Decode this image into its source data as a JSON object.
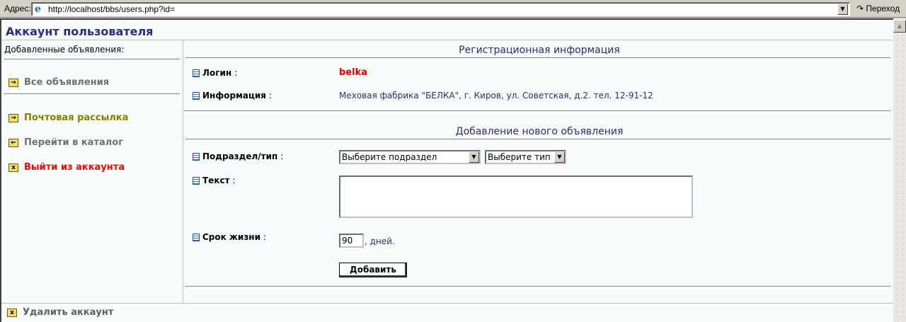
{
  "browser": {
    "address_label": "Адрес:",
    "url": "http://localhost/bbs/users.php?id=",
    "go_label": "Переход"
  },
  "page": {
    "title": "Аккаунт пользователя",
    "sidebar": {
      "heading": "Добавленные объявления:",
      "items": [
        {
          "label": "Все объявления",
          "color": "#707070"
        },
        {
          "label": "Почтовая рассылка",
          "color": "#808000"
        },
        {
          "label": "Перейти в каталог",
          "color": "#707070"
        },
        {
          "label": "Выйти из аккаунта",
          "color": "#ff0000"
        }
      ],
      "delete_account": "Удалить аккаунт"
    },
    "registration": {
      "title": "Регистрационная информация",
      "login_label": "Логин",
      "login_value": "belka",
      "info_label": "Информация",
      "info_value": "Меховая фабрика \"БЕЛКА\", г. Киров, ул. Советская, д.2. тел. 12-91-12"
    },
    "new_ad": {
      "title": "Добавление нового объявления",
      "section_label": "Подраздел/тип",
      "section_select": "Выберите подраздел",
      "type_select": "Выберите тип",
      "text_label": "Текст",
      "text_value": "",
      "lifetime_label": "Срок жизни",
      "lifetime_value": "90",
      "lifetime_unit": ", дней.",
      "submit_label": "Добавить"
    },
    "colon": ":"
  }
}
